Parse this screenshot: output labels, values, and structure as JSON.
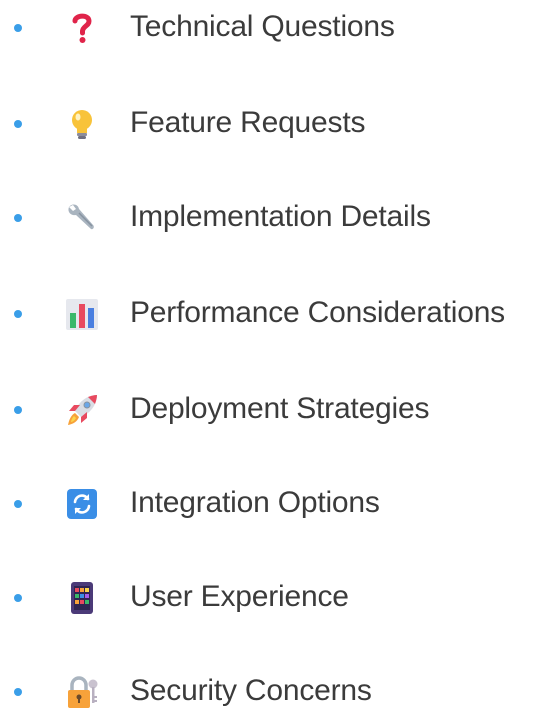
{
  "list": {
    "items": [
      {
        "label": "Technical Questions",
        "icon": "question-mark-icon"
      },
      {
        "label": "Feature Requests",
        "icon": "light-bulb-icon"
      },
      {
        "label": "Implementation Details",
        "icon": "wrench-icon"
      },
      {
        "label": "Performance Considerations",
        "icon": "bar-chart-icon"
      },
      {
        "label": "Deployment Strategies",
        "icon": "rocket-icon"
      },
      {
        "label": "Integration Options",
        "icon": "refresh-arrows-icon"
      },
      {
        "label": "User Experience",
        "icon": "mobile-app-grid-icon"
      },
      {
        "label": "Security Concerns",
        "icon": "padlock-key-icon"
      }
    ]
  },
  "colors": {
    "bullet": "#3a9ee8",
    "text": "#3b3b3b"
  }
}
